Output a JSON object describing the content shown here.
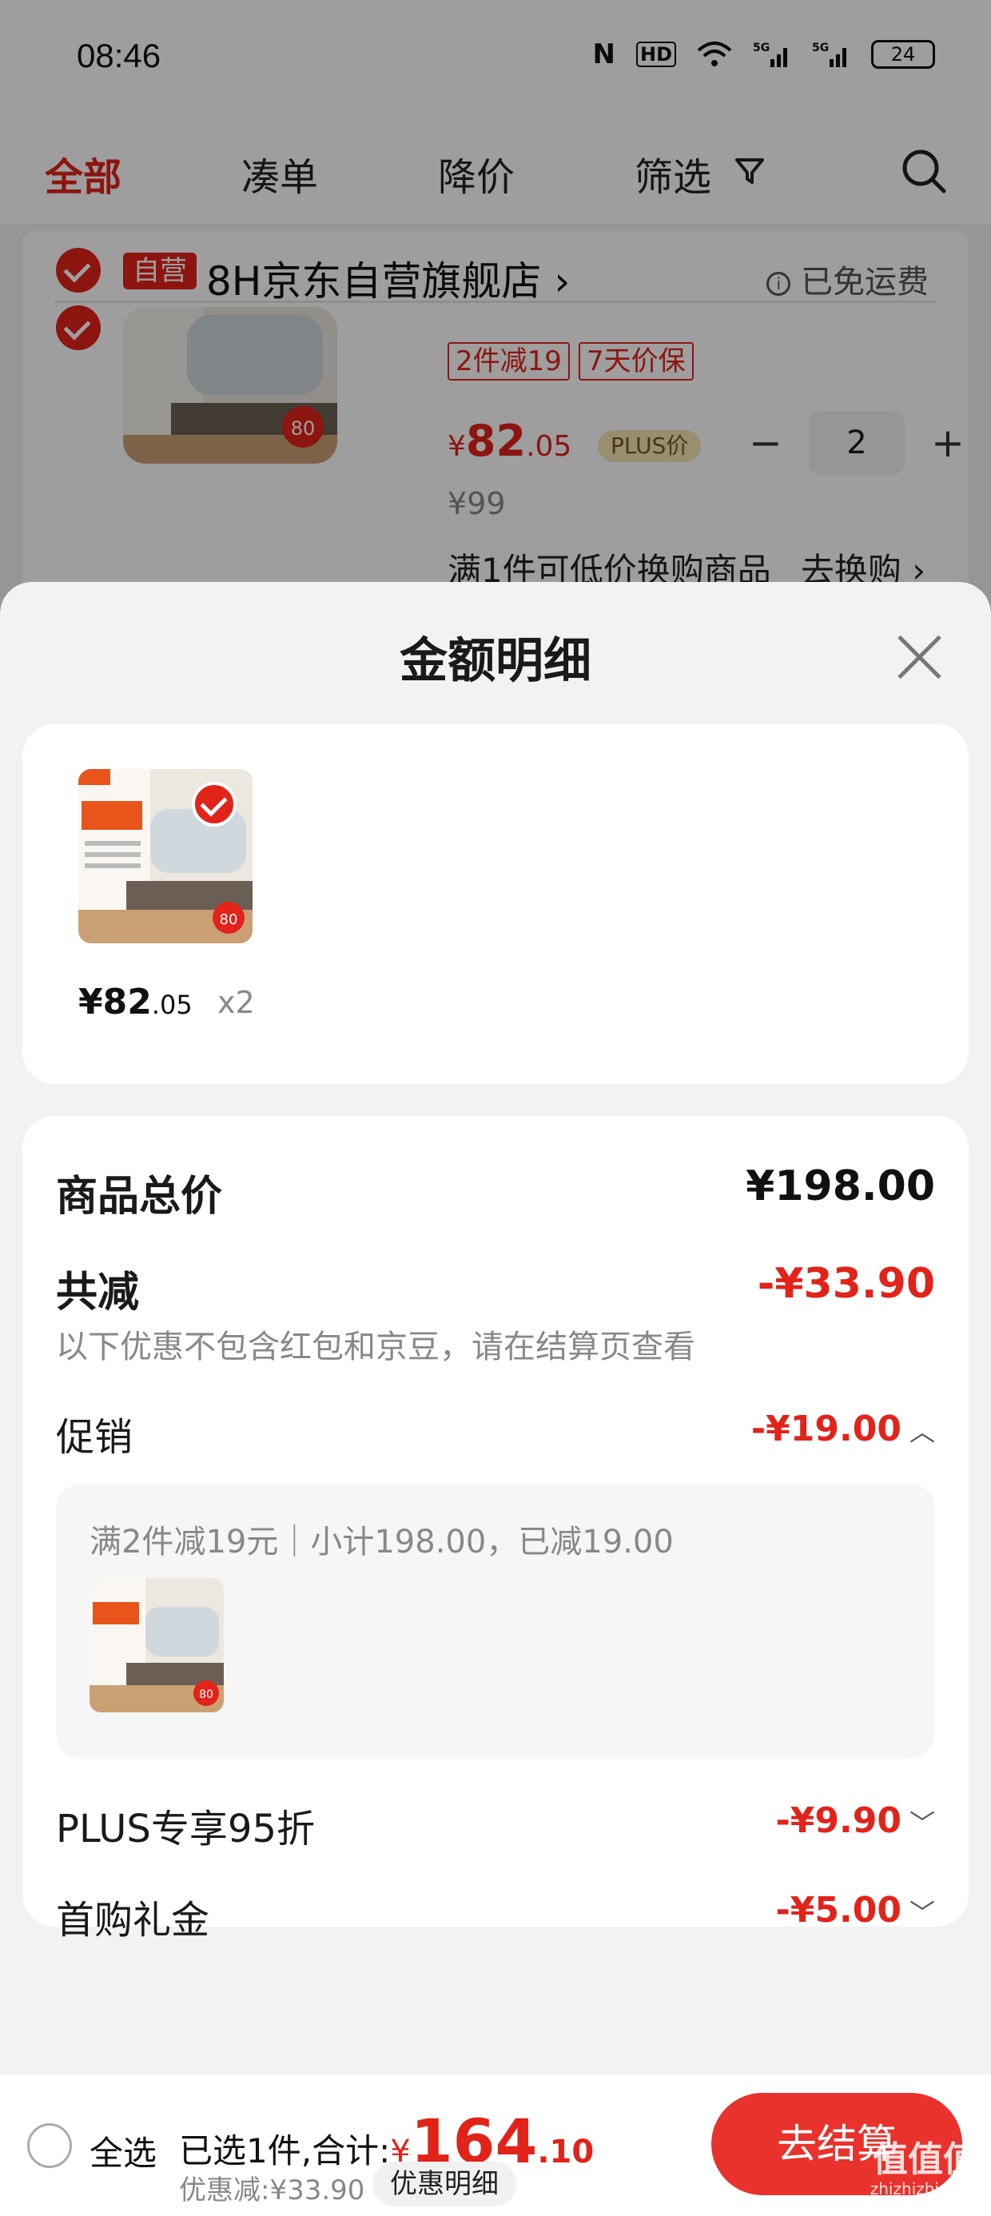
{
  "status_bar": {
    "time": "08:46",
    "icons": [
      "nfc-icon",
      "hd-icon",
      "wifi-icon",
      "signal-5g-icon",
      "signal-5g-icon",
      "battery-icon"
    ],
    "battery": "24"
  },
  "nav": {
    "tabs": [
      "全部",
      "凑单",
      "降价",
      "筛选"
    ],
    "active_tab": "全部"
  },
  "store": {
    "badge": "自营",
    "name": "8H京东自营旗舰店",
    "chevron": "›",
    "shipping": "已免运费"
  },
  "cart_item": {
    "promo_tags": [
      "2件减19",
      "7天价保"
    ],
    "price_yen": "¥",
    "price_int": "82",
    "price_dec": ".05",
    "plus_label": "PLUS价",
    "quantity": "2",
    "minus": "−",
    "plus": "+",
    "orig_price": "¥99",
    "swap_text": "满1件可低价换购商品",
    "swap_link": "去换购 ›",
    "thumb_badge": "80"
  },
  "sheet": {
    "title": "金额明细",
    "product": {
      "price_int": "¥82",
      "price_dec": ".05",
      "qty": "x2"
    },
    "total_label": "商品总价",
    "total_value": "¥198.00",
    "discount_label": "共减",
    "discount_value": "-¥33.90",
    "discount_hint": "以下优惠不包含红包和京豆，请在结算页查看",
    "promo_label": "促销",
    "promo_value": "-¥19.00",
    "promo_detail": "满2件减19元｜小计198.00，已减19.00",
    "plus_label": "PLUS专享95折",
    "plus_value": "-¥9.90",
    "first_label": "首购礼金",
    "first_value": "-¥5.00"
  },
  "bottom": {
    "select_all": "全选",
    "selected_text": "已选1件,合计:",
    "total_yen": "¥",
    "total_int": "164",
    "total_dec": ".10",
    "discount_text": "优惠减:¥33.90",
    "detail_button": "优惠明细",
    "checkout": "去结算"
  },
  "watermark": {
    "text": "值值值",
    "url": "zhizhizhi.com"
  },
  "colors": {
    "accent": "#e2231a",
    "checkout": "#e8322b"
  }
}
